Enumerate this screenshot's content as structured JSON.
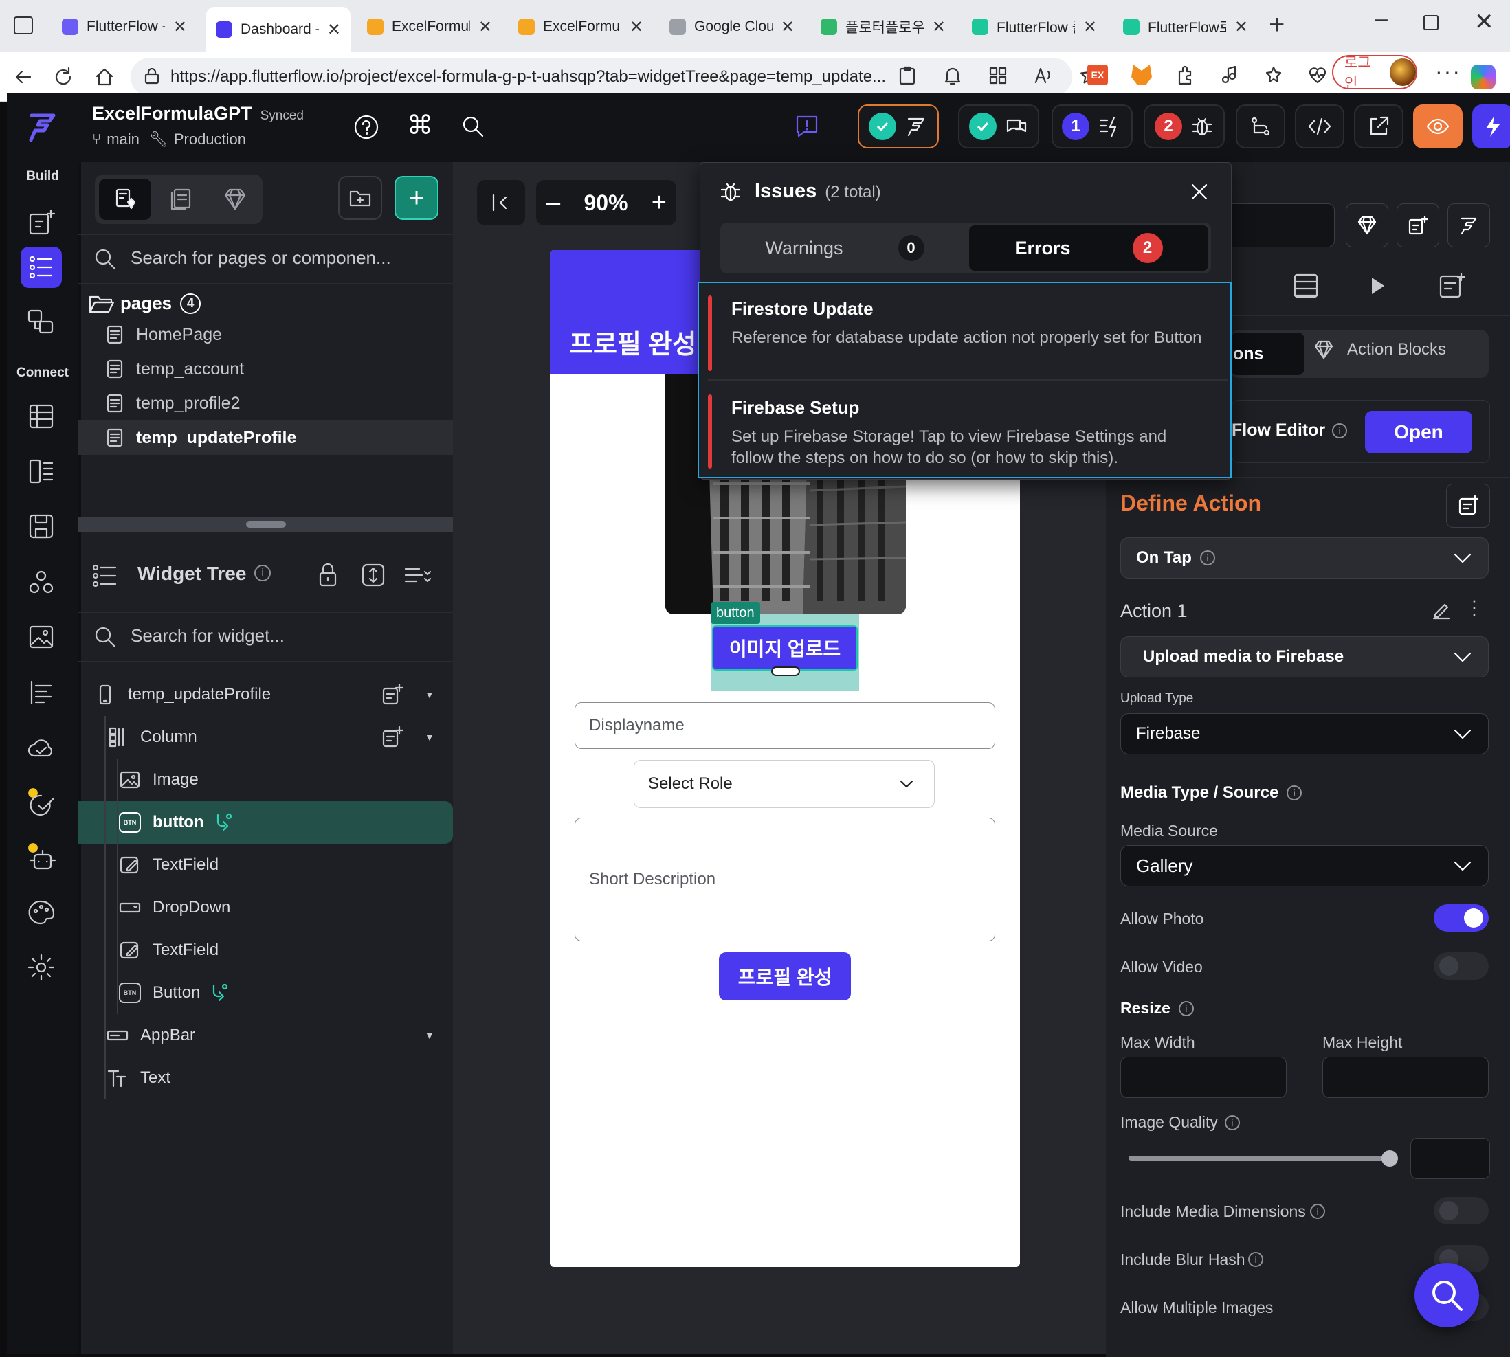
{
  "browser": {
    "tabs": [
      {
        "title": "FlutterFlow - F",
        "color": "#6b5cf6"
      },
      {
        "title": "Dashboard - F",
        "color": "#4b39ef"
      },
      {
        "title": "ExcelFormula",
        "color": "#f5a623"
      },
      {
        "title": "ExcelFormula",
        "color": "#f5a623"
      },
      {
        "title": "Google Cloud",
        "color": "#9aa0a6"
      },
      {
        "title": "플로터플로우",
        "color": "#31b86a"
      },
      {
        "title": "FlutterFlow 플",
        "color": "#1ec79a"
      },
      {
        "title": "FlutterFlow로",
        "color": "#1ec79a"
      }
    ],
    "url": "https://app.flutterflow.io/project/excel-formula-g-p-t-uahsqp?tab=widgetTree&page=temp_update...",
    "login_label": "로그인"
  },
  "project": {
    "name": "ExcelFormulaGPT",
    "sync_status": "Synced",
    "branch": "main",
    "environment": "Production"
  },
  "topbar": {
    "agent_count": "1",
    "issue_count": "2"
  },
  "rail": {
    "build_label": "Build",
    "connect_label": "Connect"
  },
  "left_panel": {
    "search_placeholder": "Search for pages or componen...",
    "pages_label": "pages",
    "pages_count": "4",
    "pages": [
      "HomePage",
      "temp_account",
      "temp_profile2",
      "temp_updateProfile"
    ],
    "widget_tree_label": "Widget Tree",
    "widget_search_placeholder": "Search for widget...",
    "tree": [
      {
        "label": "temp_updateProfile",
        "icon": "phone-icon"
      },
      {
        "label": "Column",
        "icon": "column-icon"
      },
      {
        "label": "Image",
        "icon": "image-icon"
      },
      {
        "label": "button",
        "icon": "btn-icon"
      },
      {
        "label": "TextField",
        "icon": "textfield-icon"
      },
      {
        "label": "DropDown",
        "icon": "dropdown-icon"
      },
      {
        "label": "TextField",
        "icon": "textfield-icon"
      },
      {
        "label": "Button",
        "icon": "btn-icon"
      },
      {
        "label": "AppBar",
        "icon": "appbar-icon"
      },
      {
        "label": "Text",
        "icon": "text-icon"
      }
    ]
  },
  "canvas": {
    "zoom": "90%",
    "appbar_title": "프로필 완성",
    "selected_tag": "button",
    "upload_button_label": "이미지 업로드",
    "displayname_placeholder": "Displayname",
    "select_role_label": "Select Role",
    "short_description_placeholder": "Short Description",
    "submit_button_label": "프로필 완성"
  },
  "issues": {
    "title": "Issues",
    "total": "(2 total)",
    "warnings_label": "Warnings",
    "warnings_count": "0",
    "errors_label": "Errors",
    "errors_count": "2",
    "items": [
      {
        "title": "Firestore Update",
        "desc": "Reference for database update action not properly set for Button"
      },
      {
        "title": "Firebase Setup",
        "desc": "Set up Firebase Storage! Tap to view Firebase Settings and follow the steps on how to do so (or how to skip this)."
      }
    ]
  },
  "right_panel": {
    "actions_tab_partial": "ons",
    "action_blocks_tab": "Action Blocks",
    "flow_editor_partial": "Flow Editor",
    "open_button": "Open",
    "define_action": "Define Action",
    "trigger": "On Tap",
    "action_label": "Action 1",
    "action_type": "Upload media to Firebase",
    "upload_type_label": "Upload Type",
    "upload_type": "Firebase",
    "media_type_source_label": "Media Type / Source",
    "media_source_label": "Media Source",
    "media_source": "Gallery",
    "allow_photo_label": "Allow Photo",
    "allow_photo": true,
    "allow_video_label": "Allow Video",
    "allow_video": false,
    "resize_label": "Resize",
    "max_width_label": "Max Width",
    "max_height_label": "Max Height",
    "image_quality_label": "Image Quality",
    "image_quality": 1.0,
    "include_media_dimensions_label": "Include Media Dimensions",
    "include_blur_hash_label": "Include Blur Hash",
    "allow_multiple_images_label": "Allow Multiple Images"
  },
  "colors": {
    "accent": "#4b39ef",
    "define_action": "#f07a3c",
    "teal": "#1ec7a9",
    "error_red": "#e03b3b"
  }
}
